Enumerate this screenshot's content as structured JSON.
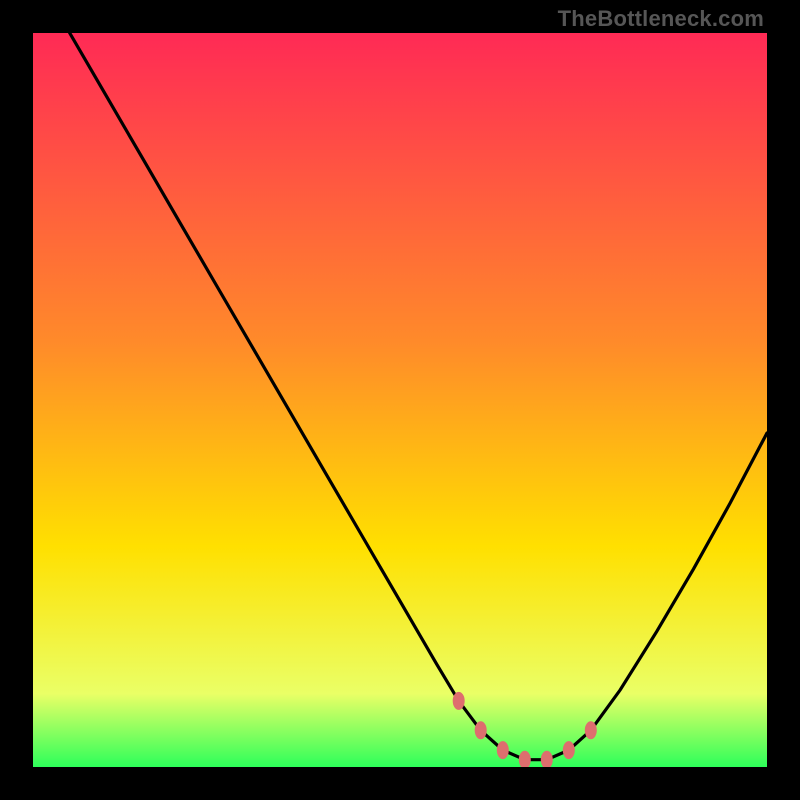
{
  "watermark": "TheBottleneck.com",
  "colors": {
    "gradient_top": "#ff2a55",
    "gradient_mid": "#ffe000",
    "gradient_bottom": "#2dff5a",
    "curve": "#000000",
    "marker": "#de6e6e",
    "frame": "#000000"
  },
  "chart_data": {
    "type": "line",
    "title": "",
    "xlabel": "",
    "ylabel": "",
    "xlim": [
      0,
      100
    ],
    "ylim": [
      0,
      100
    ],
    "series": [
      {
        "name": "bottleneck-curve",
        "x": [
          5,
          10,
          15,
          20,
          25,
          30,
          35,
          40,
          45,
          50,
          55,
          58,
          61,
          64,
          67,
          70,
          73,
          76,
          80,
          85,
          90,
          95,
          100
        ],
        "y": [
          100,
          91.4,
          82.8,
          74.2,
          65.6,
          57.0,
          48.4,
          39.8,
          31.2,
          22.6,
          14.0,
          9.0,
          5.0,
          2.3,
          1.0,
          1.0,
          2.3,
          5.0,
          10.5,
          18.5,
          27.0,
          36.0,
          45.5
        ]
      }
    ],
    "markers": [
      {
        "x": 58,
        "y": 9.0
      },
      {
        "x": 61,
        "y": 5.0
      },
      {
        "x": 64,
        "y": 2.3
      },
      {
        "x": 67,
        "y": 1.0
      },
      {
        "x": 70,
        "y": 1.0
      },
      {
        "x": 73,
        "y": 2.3
      },
      {
        "x": 76,
        "y": 5.0
      }
    ]
  }
}
